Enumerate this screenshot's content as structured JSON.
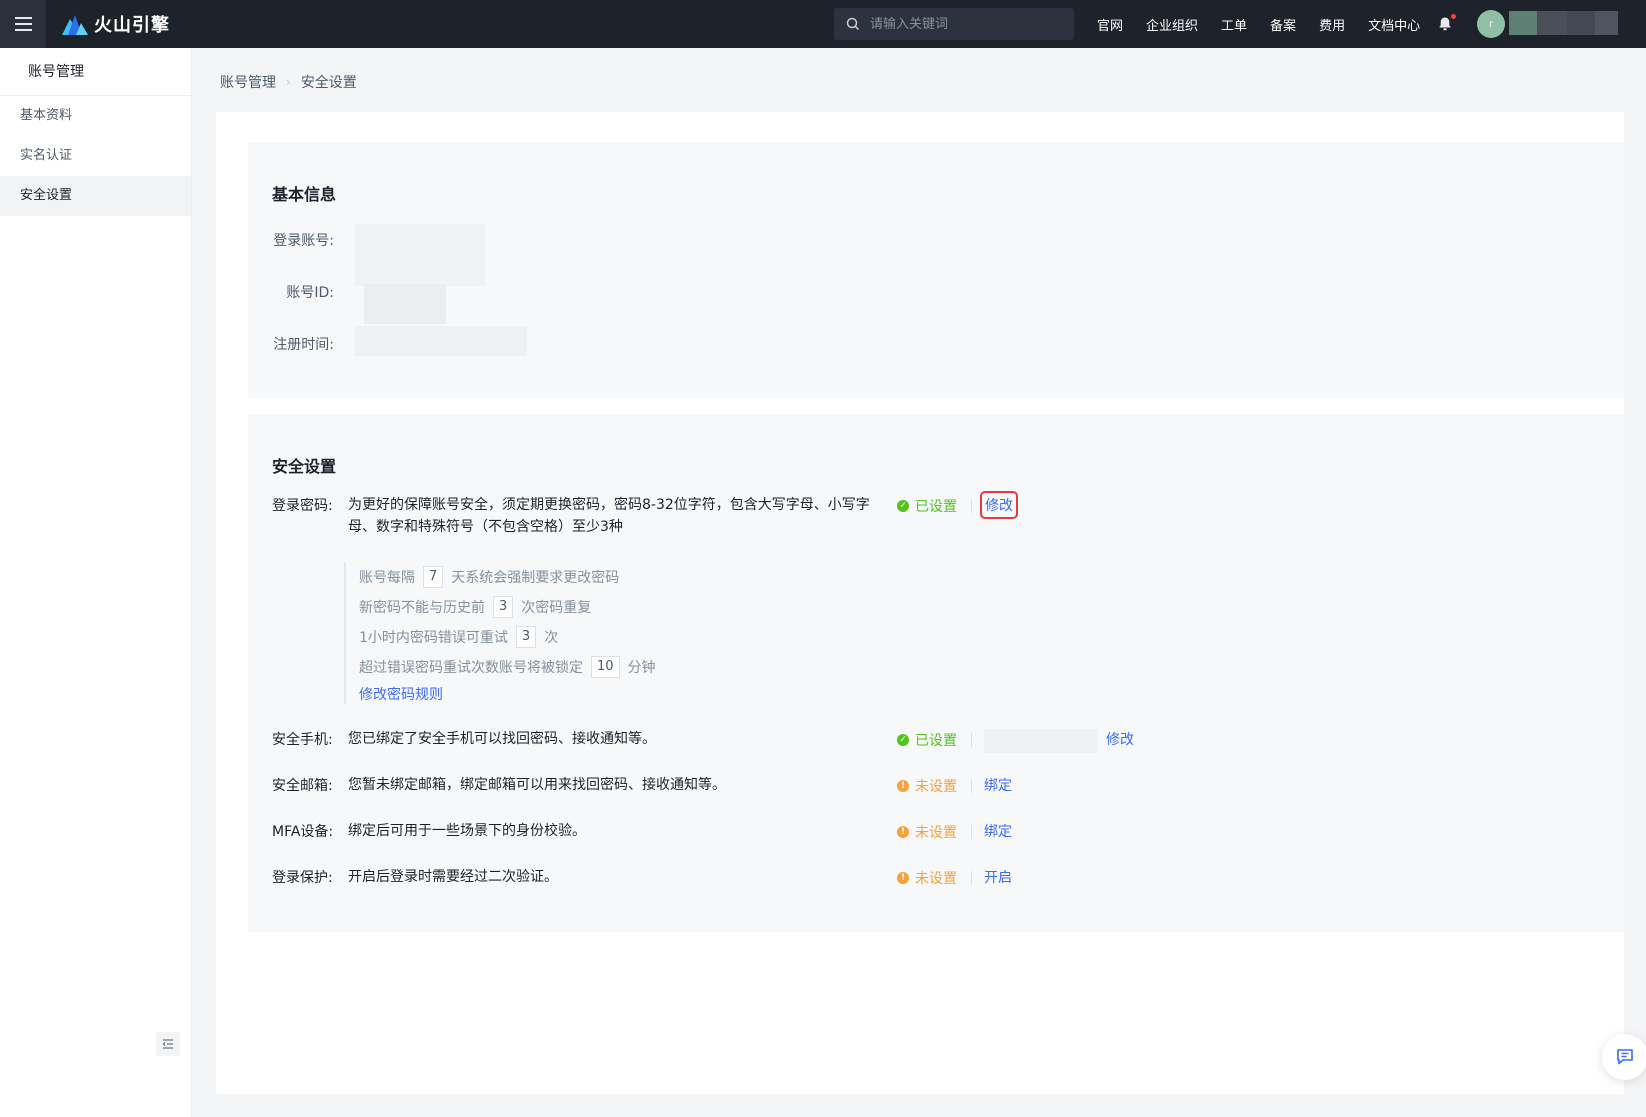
{
  "topbar": {
    "logo_text": "火山引擎",
    "search_placeholder": "请输入关键词",
    "nav": [
      "官网",
      "企业组织",
      "工单",
      "备案",
      "费用",
      "文档中心"
    ],
    "avatar_initial": "r"
  },
  "sidebar": {
    "title": "账号管理",
    "items": [
      {
        "label": "基本资料"
      },
      {
        "label": "实名认证"
      },
      {
        "label": "安全设置"
      }
    ]
  },
  "breadcrumb": {
    "parent": "账号管理",
    "current": "安全设置"
  },
  "basic_info": {
    "title": "基本信息",
    "login_account_label": "登录账号:",
    "account_id_label": "账号ID:",
    "register_time_label": "注册时间:"
  },
  "security": {
    "title": "安全设置",
    "password": {
      "label": "登录密码:",
      "desc_line1": "为更好的保障账号安全，须定期更换密码，密码8-32位字符，包含大写字母、小写字",
      "desc_line2": "母、数字和特殊符号（不包含空格）至少3种",
      "status": "已设置",
      "action": "修改",
      "rules": {
        "r1_pre": "账号每隔",
        "r1_num": "7",
        "r1_post": "天系统会强制要求更改密码",
        "r2_pre": "新密码不能与历史前",
        "r2_num": "3",
        "r2_post": "次密码重复",
        "r3_pre": "1小时内密码错误可重试",
        "r3_num": "3",
        "r3_post": "次",
        "r4_pre": "超过错误密码重试次数账号将被锁定",
        "r4_num": "10",
        "r4_post": "分钟",
        "link": "修改密码规则"
      }
    },
    "phone": {
      "label": "安全手机:",
      "desc": "您已绑定了安全手机可以找回密码、接收通知等。",
      "status": "已设置",
      "action": "修改"
    },
    "email": {
      "label": "安全邮箱:",
      "desc": "您暂未绑定邮箱，绑定邮箱可以用来找回密码、接收通知等。",
      "status": "未设置",
      "action": "绑定"
    },
    "mfa": {
      "label": "MFA设备:",
      "desc": "绑定后可用于一些场景下的身份校验。",
      "status": "未设置",
      "action": "绑定"
    },
    "login_protect": {
      "label": "登录保护:",
      "desc": "开启后登录时需要经过二次验证。",
      "status": "未设置",
      "action": "开启"
    }
  },
  "colors": {
    "topbar": "#1d222b",
    "link": "#3a6cf6",
    "ok": "#52c41a",
    "warn": "#f7a13b",
    "highlight": "#e83a3a"
  }
}
